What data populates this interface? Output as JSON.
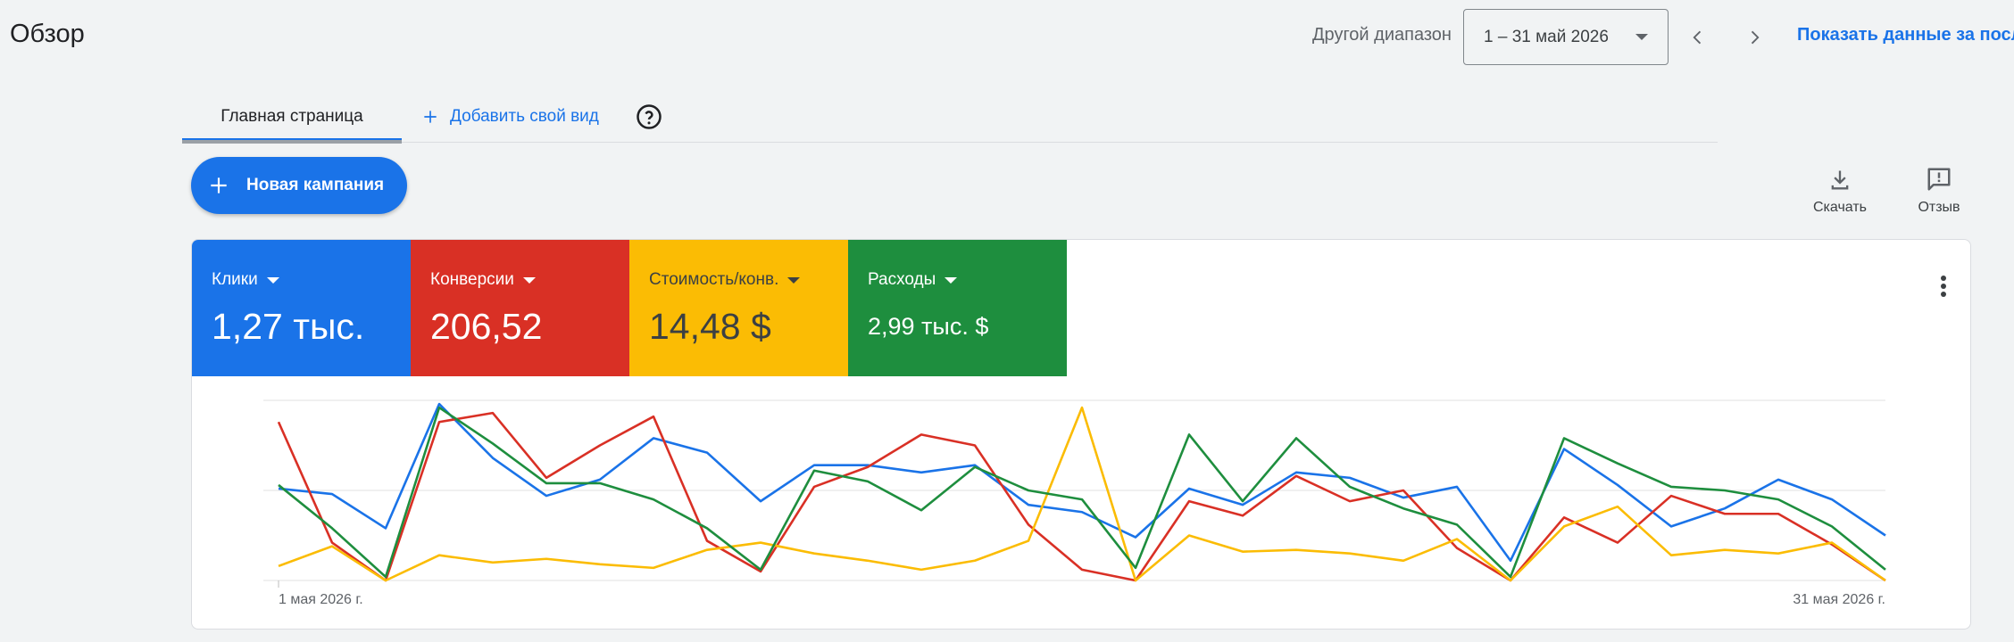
{
  "header": {
    "title": "Обзор",
    "range_label": "Другой диапазон",
    "date_range": "1 – 31 май 2026",
    "show_data_link": "Показать данные за послед"
  },
  "tabs": {
    "home": "Главная страница",
    "add_view": "Добавить свой вид"
  },
  "toolbar": {
    "new_campaign": "Новая кампания",
    "download": "Скачать",
    "feedback": "Отзыв"
  },
  "metrics": [
    {
      "label": "Клики",
      "value": "1,27 тыс.",
      "color": "#1a73e8"
    },
    {
      "label": "Конверсии",
      "value": "206,52",
      "color": "#d93025"
    },
    {
      "label": "Стоимость/конв.",
      "value": "14,48 $",
      "color": "#fbbc04"
    },
    {
      "label": "Расходы",
      "value": "2,99 тыс. $",
      "color": "#1e8e3e"
    }
  ],
  "chart_data": {
    "type": "line",
    "x": [
      "1 мая 2026 г.",
      "2",
      "3",
      "4",
      "5",
      "6",
      "7",
      "8",
      "9",
      "10",
      "11",
      "12",
      "13",
      "14",
      "15",
      "16",
      "17",
      "18",
      "19",
      "20",
      "21",
      "22",
      "23",
      "24",
      "25",
      "26",
      "27",
      "28",
      "29",
      "30",
      "31 мая 2026 г."
    ],
    "x_tick_labels": [
      "1 мая 2026 г.",
      "31 мая 2026 г."
    ],
    "ylim": [
      0,
      100
    ],
    "grid": true,
    "series": [
      {
        "color": "#1a73e8",
        "values": [
          51,
          48,
          29,
          98,
          68,
          47,
          56,
          79,
          71,
          44,
          64,
          64,
          60,
          64,
          42,
          38,
          24,
          51,
          42,
          60,
          57,
          46,
          52,
          11,
          73,
          53,
          30,
          40,
          56,
          45,
          25
        ]
      },
      {
        "color": "#d93025",
        "values": [
          88,
          21,
          0,
          88,
          93,
          57,
          75,
          91,
          22,
          5,
          52,
          63,
          81,
          75,
          31,
          6,
          0,
          44,
          36,
          58,
          44,
          50,
          18,
          0,
          35,
          21,
          47,
          37,
          37,
          20,
          0
        ]
      },
      {
        "color": "#fbbc04",
        "values": [
          8,
          19,
          0,
          14,
          10,
          12,
          9,
          7,
          17,
          21,
          15,
          11,
          6,
          11,
          22,
          96,
          0,
          25,
          16,
          17,
          15,
          11,
          23,
          0,
          30,
          41,
          14,
          17,
          15,
          21,
          0
        ]
      },
      {
        "color": "#1e8e3e",
        "values": [
          53,
          29,
          2,
          96,
          76,
          54,
          54,
          45,
          29,
          6,
          61,
          55,
          39,
          63,
          50,
          45,
          7,
          81,
          44,
          79,
          52,
          40,
          31,
          2,
          79,
          65,
          52,
          50,
          45,
          30,
          6
        ]
      }
    ]
  }
}
